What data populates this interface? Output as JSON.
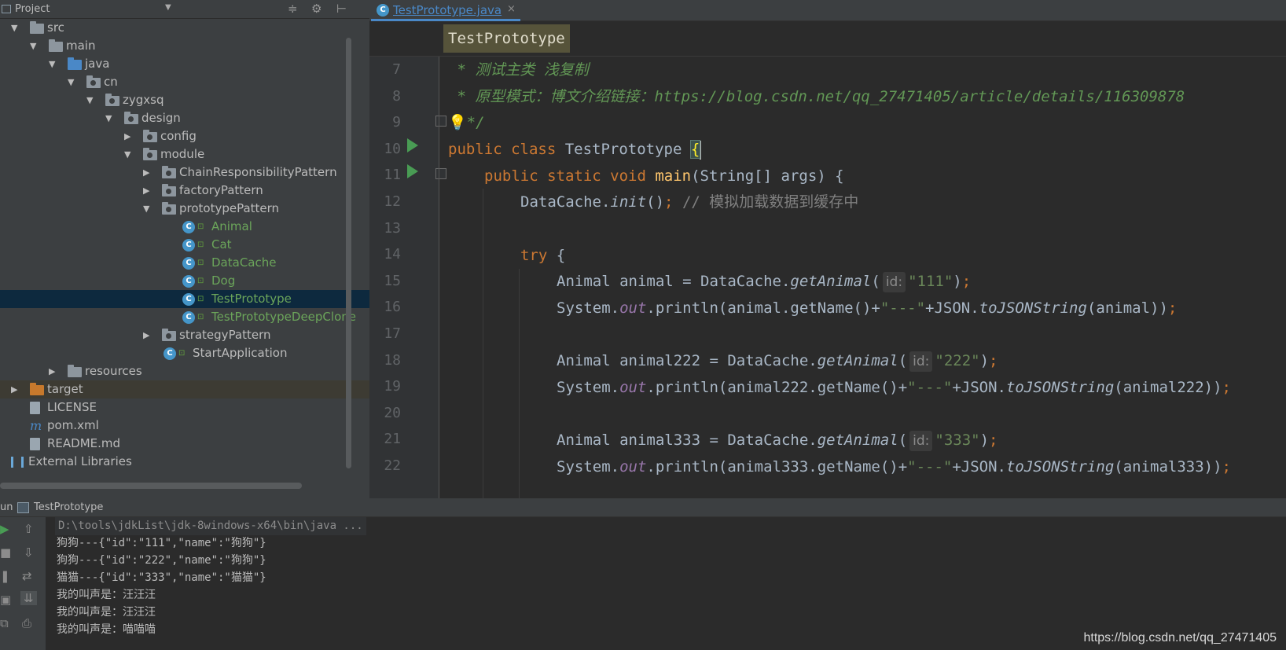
{
  "project": {
    "title": "Project",
    "tree": [
      {
        "label": "src",
        "depth": 0,
        "expanded": true,
        "kind": "folder"
      },
      {
        "label": "main",
        "depth": 1,
        "expanded": true,
        "kind": "folder"
      },
      {
        "label": "java",
        "depth": 2,
        "expanded": true,
        "kind": "folder-blue"
      },
      {
        "label": "cn",
        "depth": 3,
        "expanded": true,
        "kind": "package"
      },
      {
        "label": "zygxsq",
        "depth": 4,
        "expanded": true,
        "kind": "package"
      },
      {
        "label": "design",
        "depth": 5,
        "expanded": true,
        "kind": "package"
      },
      {
        "label": "config",
        "depth": 6,
        "expanded": false,
        "kind": "package"
      },
      {
        "label": "module",
        "depth": 6,
        "expanded": true,
        "kind": "package"
      },
      {
        "label": "ChainResponsibilityPattern",
        "depth": 7,
        "expanded": false,
        "kind": "package"
      },
      {
        "label": "factoryPattern",
        "depth": 7,
        "expanded": false,
        "kind": "package"
      },
      {
        "label": "prototypePattern",
        "depth": 7,
        "expanded": true,
        "kind": "package"
      },
      {
        "label": "Animal",
        "depth": 8,
        "kind": "class"
      },
      {
        "label": "Cat",
        "depth": 8,
        "kind": "class"
      },
      {
        "label": "DataCache",
        "depth": 8,
        "kind": "class"
      },
      {
        "label": "Dog",
        "depth": 8,
        "kind": "class"
      },
      {
        "label": "TestPrototype",
        "depth": 8,
        "kind": "class",
        "selected": true
      },
      {
        "label": "TestPrototypeDeepClone",
        "depth": 8,
        "kind": "class"
      },
      {
        "label": "strategyPattern",
        "depth": 7,
        "expanded": false,
        "kind": "package"
      },
      {
        "label": "StartApplication",
        "depth": 7,
        "kind": "app-class"
      },
      {
        "label": "resources",
        "depth": 2,
        "expanded": false,
        "kind": "folder"
      },
      {
        "label": "target",
        "depth": 0,
        "expanded": false,
        "kind": "folder-orange"
      },
      {
        "label": "LICENSE",
        "depth": 0,
        "kind": "file"
      },
      {
        "label": "pom.xml",
        "depth": 0,
        "kind": "maven"
      },
      {
        "label": "README.md",
        "depth": 0,
        "kind": "file"
      },
      {
        "label": "External Libraries",
        "depth": -1,
        "expanded": false,
        "kind": "libraries"
      }
    ]
  },
  "editor": {
    "tab_label": "TestPrototype.java",
    "tab_close": "×",
    "breadcrumb": "TestPrototype",
    "line_numbers": [
      "7",
      "8",
      "9",
      "10",
      "11",
      "12",
      "13",
      "14",
      "15",
      "16",
      "17",
      "18",
      "19",
      "20",
      "21",
      "22"
    ],
    "l7": {
      "text": " * 测试主类 浅复制"
    },
    "l8": {
      "text": " * 原型模式：博文介绍链接：https://blog.csdn.net/qq_27471405/article/details/116309878"
    },
    "l9": {
      "bulb": "💡",
      "text": "*/"
    },
    "l10": {
      "kw1": "public class ",
      "name": "TestPrototype ",
      "brace": "{"
    },
    "l11": {
      "kw1": "public static void ",
      "fn": "main",
      "rest": "(String[] args) {"
    },
    "l12": {
      "a": "DataCache.",
      "m": "init",
      "b": "()",
      "semi": "; ",
      "cmt": "// 模拟加载数据到缓存中"
    },
    "l14": {
      "kw": "try",
      "rest": " {"
    },
    "l15": {
      "a": "Animal animal = DataCache.",
      "m": "getAnimal",
      "p": "(",
      "hint": "id:",
      "str": "\"111\"",
      "close": ")",
      "semi": ";"
    },
    "l16": {
      "a": "System.",
      "out": "out",
      "b": ".println(animal.getName()+",
      "str": "\"---\"",
      "c": "+JSON.",
      "m": "toJSONString",
      "d": "(animal))",
      "semi": ";"
    },
    "l18": {
      "a": "Animal animal222 = DataCache.",
      "m": "getAnimal",
      "p": "(",
      "hint": "id:",
      "str": "\"222\"",
      "close": ")",
      "semi": ";"
    },
    "l19": {
      "a": "System.",
      "out": "out",
      "b": ".println(animal222.getName()+",
      "str": "\"---\"",
      "c": "+JSON.",
      "m": "toJSONString",
      "d": "(animal222))",
      "semi": ";"
    },
    "l21": {
      "a": "Animal animal333 = DataCache.",
      "m": "getAnimal",
      "p": "(",
      "hint": "id:",
      "str": "\"333\"",
      "close": ")",
      "semi": ";"
    },
    "l22": {
      "a": "System.",
      "out": "out",
      "b": ".println(animal333.getName()+",
      "str": "\"---\"",
      "c": "+JSON.",
      "m": "toJSONString",
      "d": "(animal333))",
      "semi": ";"
    }
  },
  "run": {
    "prefix": "un",
    "title": "TestPrototype",
    "console": [
      "D:\\tools\\jdkList\\jdk-8windows-x64\\bin\\java ...",
      "狗狗---{\"id\":\"111\",\"name\":\"狗狗\"}",
      "狗狗---{\"id\":\"222\",\"name\":\"狗狗\"}",
      "猫猫---{\"id\":\"333\",\"name\":\"猫猫\"}",
      "我的叫声是：汪汪汪",
      "我的叫声是：汪汪汪",
      "我的叫声是：喵喵喵"
    ]
  },
  "watermark": "https://blog.csdn.net/qq_27471405",
  "icons": {
    "project": "project-icon",
    "dropdown": "chevron-down-icon",
    "collapse": "collapse-all-icon",
    "settings": "gear-icon",
    "hide": "hide-icon",
    "run": "run-icon",
    "up": "arrow-up-icon",
    "down": "arrow-down-icon"
  },
  "colors": {
    "keyword": "#cc7832",
    "string": "#6a8759",
    "doc_comment": "#629755",
    "function": "#ffc66d",
    "selection": "#0d293e",
    "tab_accent": "#4a88c7"
  }
}
